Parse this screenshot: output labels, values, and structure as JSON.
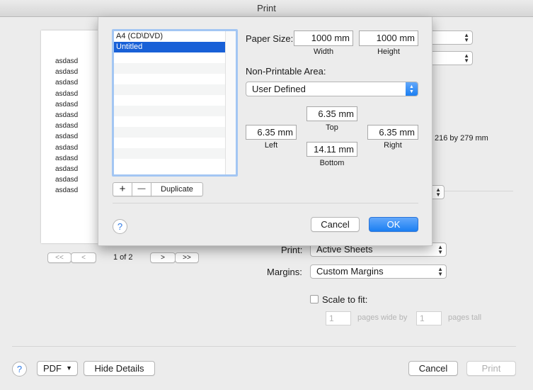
{
  "window": {
    "title": "Print"
  },
  "preview": {
    "lines": [
      "asdasd",
      "asdasd",
      "asdasd",
      "asdasd",
      "asdasd",
      "asdasd",
      "asdasd",
      "asdasd",
      "asdasd",
      "asdasd",
      "asdasd",
      "asdasd",
      "asdasd"
    ],
    "page_indicator": "1 of 2",
    "nav_first": "<<",
    "nav_prev": "<",
    "nav_next": ">",
    "nav_last": ">>"
  },
  "background_panel": {
    "paper_size_text": "216 by 279 mm",
    "print_label": "Print:",
    "print_value": "Active Sheets",
    "margins_label": "Margins:",
    "margins_value": "Custom Margins",
    "scale_to_fit_label": "Scale to fit:",
    "scale_to_fit_checked": false,
    "pages_wide_value": "1",
    "pages_wide_label": "pages wide by",
    "pages_tall_value": "1",
    "pages_tall_label": "pages tall"
  },
  "footer": {
    "help": "?",
    "pdf_label": "PDF",
    "hide_details_label": "Hide Details",
    "cancel_label": "Cancel",
    "print_label": "Print"
  },
  "sheet": {
    "paper_list": [
      {
        "label": "A4 (CD\\DVD)",
        "selected": false
      },
      {
        "label": "Untitled",
        "selected": true
      }
    ],
    "add_label": "+",
    "remove_label": "—",
    "duplicate_label": "Duplicate",
    "paper_size_label": "Paper Size:",
    "width_value": "1000 mm",
    "width_label": "Width",
    "height_value": "1000 mm",
    "height_label": "Height",
    "non_printable_label": "Non-Printable Area:",
    "non_printable_value": "User Defined",
    "top_value": "6.35 mm",
    "top_label": "Top",
    "left_value": "6.35 mm",
    "left_label": "Left",
    "right_value": "6.35 mm",
    "right_label": "Right",
    "bottom_value": "14.11 mm",
    "bottom_label": "Bottom",
    "help": "?",
    "cancel_label": "Cancel",
    "ok_label": "OK"
  },
  "colors": {
    "accent": "#1b7ff2",
    "selection": "#1860d7",
    "list_focus_ring": "#a3c6f3"
  }
}
